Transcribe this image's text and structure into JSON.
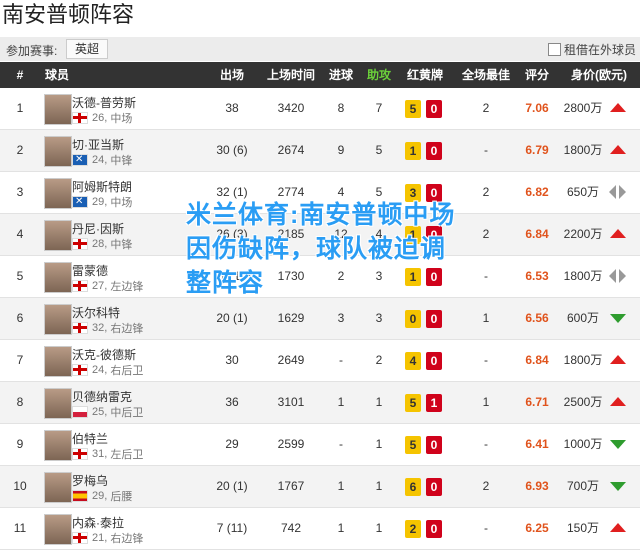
{
  "page": {
    "title": "南安普顿阵容"
  },
  "competition": {
    "label": "参加赛事:",
    "selected": "英超"
  },
  "loan_toggle": {
    "label": "租借在外球员"
  },
  "headers": {
    "num": "#",
    "player": "球员",
    "apps": "出场",
    "minutes": "上场时间",
    "goals": "进球",
    "assists": "助攻",
    "cards": "红黄牌",
    "motm": "全场最佳",
    "rating": "评分",
    "value": "身价(欧元)"
  },
  "colors": {
    "header_bg": "#333333",
    "assist_header": "#6bd13a",
    "rating": "#e0531c",
    "yellow": "#f5c400",
    "red": "#d0021b",
    "watermark": "#2a9df4"
  },
  "players": [
    {
      "num": "1",
      "name": "沃德-普劳斯",
      "flag": "eng",
      "age": "26",
      "position": "中场",
      "apps": "38",
      "minutes": "3420",
      "goals": "8",
      "assists": "7",
      "yellow": "5",
      "red": "0",
      "motm": "2",
      "rating": "7.06",
      "value": "2800万",
      "trend": "up"
    },
    {
      "num": "2",
      "name": "切·亚当斯",
      "flag": "sco",
      "age": "24",
      "position": "中锋",
      "apps": "30 (6)",
      "minutes": "2674",
      "goals": "9",
      "assists": "5",
      "yellow": "1",
      "red": "0",
      "motm": "-",
      "rating": "6.79",
      "value": "1800万",
      "trend": "up"
    },
    {
      "num": "3",
      "name": "阿姆斯特朗",
      "flag": "sco",
      "age": "29",
      "position": "中场",
      "apps": "32 (1)",
      "minutes": "2774",
      "goals": "4",
      "assists": "5",
      "yellow": "3",
      "red": "0",
      "motm": "2",
      "rating": "6.82",
      "value": "650万",
      "trend": "same"
    },
    {
      "num": "4",
      "name": "丹尼·因斯",
      "flag": "eng",
      "age": "28",
      "position": "中锋",
      "apps": "26 (3)",
      "minutes": "2185",
      "goals": "12",
      "assists": "4",
      "yellow": "1",
      "red": "0",
      "motm": "2",
      "rating": "6.84",
      "value": "2200万",
      "trend": "up"
    },
    {
      "num": "5",
      "name": "雷蒙德",
      "flag": "eng",
      "age": "27",
      "position": "左边锋",
      "apps": "17 (12)",
      "minutes": "1730",
      "goals": "2",
      "assists": "3",
      "yellow": "1",
      "red": "0",
      "motm": "-",
      "rating": "6.53",
      "value": "1800万",
      "trend": "same"
    },
    {
      "num": "6",
      "name": "沃尔科特",
      "flag": "eng",
      "age": "32",
      "position": "右边锋",
      "apps": "20 (1)",
      "minutes": "1629",
      "goals": "3",
      "assists": "3",
      "yellow": "0",
      "red": "0",
      "motm": "1",
      "rating": "6.56",
      "value": "600万",
      "trend": "down"
    },
    {
      "num": "7",
      "name": "沃克-彼德斯",
      "flag": "eng",
      "age": "24",
      "position": "右后卫",
      "apps": "30",
      "minutes": "2649",
      "goals": "-",
      "assists": "2",
      "yellow": "4",
      "red": "0",
      "motm": "-",
      "rating": "6.84",
      "value": "1800万",
      "trend": "up"
    },
    {
      "num": "8",
      "name": "贝德纳雷克",
      "flag": "pol",
      "age": "25",
      "position": "中后卫",
      "apps": "36",
      "minutes": "3101",
      "goals": "1",
      "assists": "1",
      "yellow": "5",
      "red": "1",
      "motm": "1",
      "rating": "6.71",
      "value": "2500万",
      "trend": "up"
    },
    {
      "num": "9",
      "name": "伯特兰",
      "flag": "eng",
      "age": "31",
      "position": "左后卫",
      "apps": "29",
      "minutes": "2599",
      "goals": "-",
      "assists": "1",
      "yellow": "5",
      "red": "0",
      "motm": "-",
      "rating": "6.41",
      "value": "1000万",
      "trend": "down"
    },
    {
      "num": "10",
      "name": "罗梅乌",
      "flag": "esp",
      "age": "29",
      "position": "后腰",
      "apps": "20 (1)",
      "minutes": "1767",
      "goals": "1",
      "assists": "1",
      "yellow": "6",
      "red": "0",
      "motm": "2",
      "rating": "6.93",
      "value": "700万",
      "trend": "down"
    },
    {
      "num": "11",
      "name": "内森·泰拉",
      "flag": "eng",
      "age": "21",
      "position": "右边锋",
      "apps": "7 (11)",
      "minutes": "742",
      "goals": "1",
      "assists": "1",
      "yellow": "2",
      "red": "0",
      "motm": "-",
      "rating": "6.25",
      "value": "150万",
      "trend": "up"
    }
  ],
  "watermark": {
    "text": "米兰体育:南安普顿中场因伤缺阵，球队被迫调整阵容"
  }
}
